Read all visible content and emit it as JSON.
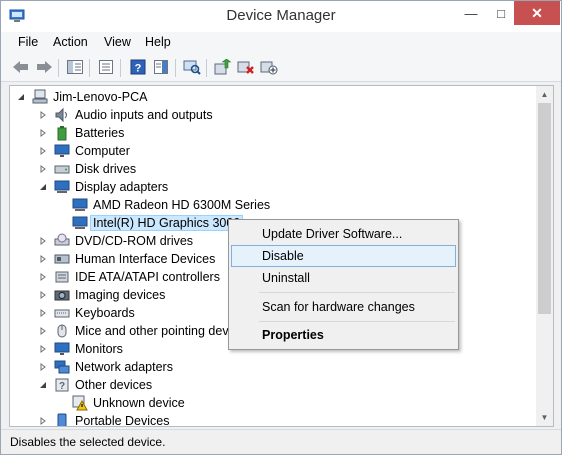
{
  "window": {
    "title": "Device Manager",
    "minimize_icon": "minimize-icon",
    "maximize_icon": "maximize-icon",
    "close_icon": "close-icon"
  },
  "menubar": {
    "items": [
      {
        "label": "File"
      },
      {
        "label": "Action"
      },
      {
        "label": "View"
      },
      {
        "label": "Help"
      }
    ]
  },
  "toolbar": {
    "buttons": [
      {
        "icon": "back-arrow-icon"
      },
      {
        "icon": "forward-arrow-icon"
      },
      {
        "icon": "show-hide-console-tree-icon"
      },
      {
        "icon": "properties-icon"
      },
      {
        "icon": "help-icon"
      },
      {
        "icon": "action-pane-icon"
      },
      {
        "icon": "scan-hardware-changes-icon"
      },
      {
        "icon": "update-driver-icon"
      },
      {
        "icon": "uninstall-device-icon"
      },
      {
        "icon": "add-legacy-hardware-icon"
      }
    ]
  },
  "tree": {
    "root": {
      "label": "Jim-Lenovo-PCA",
      "expanded": true,
      "icon": "computer-root-icon"
    },
    "nodes": [
      {
        "label": "Audio inputs and outputs",
        "icon": "speaker-icon",
        "expander": "collapsed"
      },
      {
        "label": "Batteries",
        "icon": "battery-icon",
        "expander": "collapsed"
      },
      {
        "label": "Computer",
        "icon": "monitor-icon",
        "expander": "collapsed"
      },
      {
        "label": "Disk drives",
        "icon": "disk-drive-icon",
        "expander": "collapsed"
      },
      {
        "label": "Display adapters",
        "icon": "display-adapter-icon",
        "expander": "expanded"
      },
      {
        "label": "AMD Radeon HD 6300M Series",
        "icon": "display-adapter-icon",
        "expander": "none",
        "child": true
      },
      {
        "label": "Intel(R) HD Graphics 3000",
        "icon": "display-adapter-icon",
        "expander": "none",
        "child": true,
        "selected": true
      },
      {
        "label": "DVD/CD-ROM drives",
        "icon": "dvd-drive-icon",
        "expander": "collapsed"
      },
      {
        "label": "Human Interface Devices",
        "icon": "hid-icon",
        "expander": "collapsed"
      },
      {
        "label": "IDE ATA/ATAPI controllers",
        "icon": "ide-controller-icon",
        "expander": "collapsed"
      },
      {
        "label": "Imaging devices",
        "icon": "camera-icon",
        "expander": "collapsed"
      },
      {
        "label": "Keyboards",
        "icon": "keyboard-icon",
        "expander": "collapsed"
      },
      {
        "label": "Mice and other pointing devices",
        "icon": "mouse-icon",
        "expander": "collapsed"
      },
      {
        "label": "Monitors",
        "icon": "monitor-icon",
        "expander": "collapsed"
      },
      {
        "label": "Network adapters",
        "icon": "network-adapter-icon",
        "expander": "collapsed"
      },
      {
        "label": "Other devices",
        "icon": "question-device-icon",
        "expander": "expanded"
      },
      {
        "label": "Unknown device",
        "icon": "warning-device-icon",
        "expander": "none",
        "child": true
      },
      {
        "label": "Portable Devices",
        "icon": "portable-device-icon",
        "expander": "collapsed"
      }
    ]
  },
  "context_menu": {
    "items": [
      {
        "label": "Update Driver Software...",
        "highlighted": false,
        "bold": false
      },
      {
        "label": "Disable",
        "highlighted": true,
        "bold": false
      },
      {
        "label": "Uninstall",
        "highlighted": false,
        "bold": false
      },
      {
        "label": "Scan for hardware changes",
        "highlighted": false,
        "bold": false
      },
      {
        "label": "Properties",
        "highlighted": false,
        "bold": true
      }
    ]
  },
  "statusbar": {
    "text": "Disables the selected device."
  },
  "colors": {
    "selection_fill": "#cce8ff",
    "menu_highlight": "#e5f1fb",
    "close_button": "#c75050"
  }
}
